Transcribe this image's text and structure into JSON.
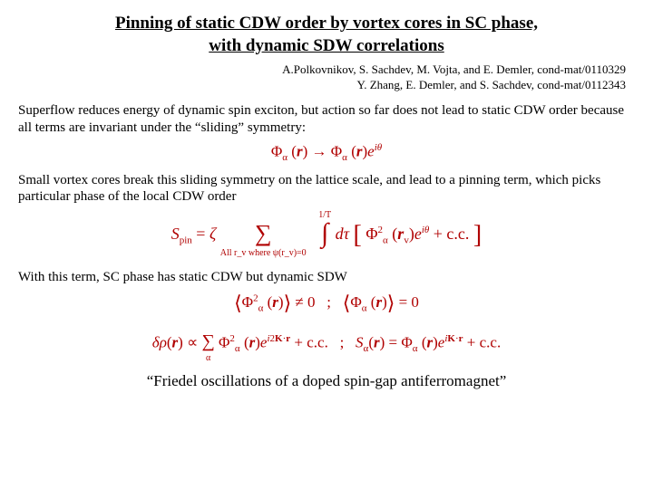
{
  "title_line1": "Pinning of static CDW order by vortex cores in SC phase,",
  "title_line2": "with dynamic SDW correlations",
  "ref1": "A.Polkovnikov, S. Sachdev, M. Vojta, and E. Demler, cond-mat/0110329",
  "ref2": "Y. Zhang, E. Demler, and S. Sachdev, cond-mat/0112343",
  "para1": "Superflow reduces energy of dynamic spin exciton, but action so far does not lead to static CDW order because all terms are invariant under the “sliding” symmetry:",
  "para2": "Small vortex cores break this sliding symmetry on the lattice scale, and lead to a pinning term, which picks particular phase of the local CDW order",
  "para3": "With this term, SC phase has static CDW but dynamic SDW",
  "quote": "“Friedel oscillations of a doped spin-gap antiferromagnet”",
  "eq1": "Φₐ(r) → Φₐ(r) e^{iθ}",
  "eq2_lhs": "S_pin = ζ",
  "eq2_sum_label": "All r_v where ψ(r_v)=0",
  "eq2_int_upper": "1/T",
  "eq2_body": "dτ [ Φₐ²(r_v) e^{iθ} + c.c. ]",
  "eq3a": "⟨Φₐ²(r)⟩ ≠ 0",
  "eq3b": "⟨Φₐ(r)⟩ = 0",
  "eq4a": "δρ(r) ∝ Σ_α Φₐ²(r) e^{i2K·r} + c.c.",
  "eq4b": "S_α(r) = Φ_α(r) e^{iK·r} + c.c."
}
